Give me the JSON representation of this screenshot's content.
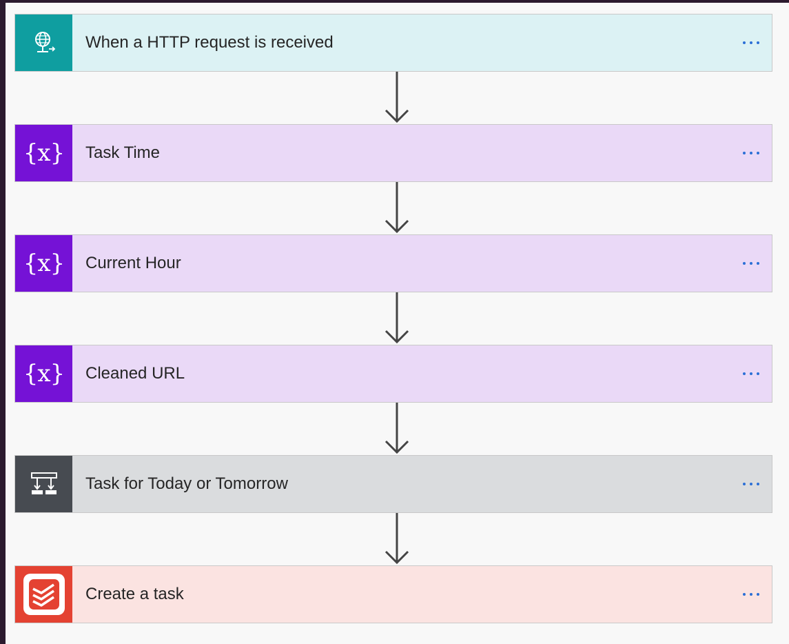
{
  "flow": {
    "steps": [
      {
        "label": "When a HTTP request is received",
        "icon": "http-request-globe-icon",
        "icon_bg": "#0f9ea0",
        "card_bg": "#dcf2f4"
      },
      {
        "label": "Task Time",
        "icon": "variable-icon",
        "icon_bg": "#7512d6",
        "card_bg": "#ead9f7"
      },
      {
        "label": "Current Hour",
        "icon": "variable-icon",
        "icon_bg": "#7512d6",
        "card_bg": "#ead9f7"
      },
      {
        "label": "Cleaned URL",
        "icon": "variable-icon",
        "icon_bg": "#7512d6",
        "card_bg": "#ead9f7"
      },
      {
        "label": "Task for Today or Tomorrow",
        "icon": "condition-icon",
        "icon_bg": "#474b51",
        "card_bg": "#dadcde"
      },
      {
        "label": "Create a task",
        "icon": "todoist-icon",
        "icon_bg": "#e44232",
        "card_bg": "#fbe3e1"
      }
    ],
    "more_menu_icon": "ellipsis-icon",
    "variable_glyph": "{x}"
  }
}
